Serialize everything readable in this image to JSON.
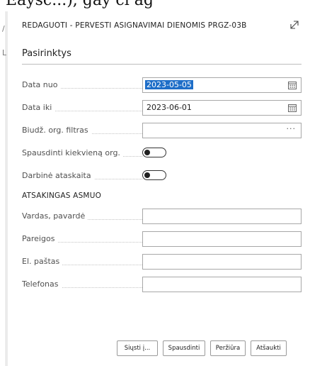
{
  "backdrop_text": "Eaysc...),  gay  ci  ag",
  "dialog": {
    "title": "REDAGUOTI - PERVESTI ASIGNAVIMAI DIENOMIS PRGZ-03B",
    "expand_icon": "expand-diagonal-arrow-icon",
    "section_title": "Pasirinktys",
    "fields": {
      "date_from": {
        "label": "Data nuo",
        "value": "2023-05-05",
        "icon": "calendar-icon"
      },
      "date_to": {
        "label": "Data iki",
        "value": "2023-06-01",
        "icon": "calendar-icon"
      },
      "budget_org_filter": {
        "label": "Biudž. org. filtras",
        "value": "",
        "icon": "ellipsis-icon",
        "ellipsis": "···"
      },
      "print_each_org": {
        "label": "Spausdinti kiekvieną org.",
        "state": "off"
      },
      "working_report": {
        "label": "Darbinė ataskaita",
        "state": "off"
      }
    },
    "responsible": {
      "heading": "ATSAKINGAS ASMUO",
      "name": {
        "label": "Vardas, pavardė",
        "value": ""
      },
      "position": {
        "label": "Pareigos",
        "value": ""
      },
      "email": {
        "label": "El. paštas",
        "value": ""
      },
      "phone": {
        "label": "Telefonas",
        "value": ""
      }
    },
    "buttons": {
      "send": "Siųsti į...",
      "print": "Spausdinti",
      "preview": "Peržiūra",
      "cancel": "Atšaukti"
    }
  },
  "colors": {
    "selection": "#1e6ec8",
    "border": "#a8a8a8",
    "text": "#212121"
  }
}
